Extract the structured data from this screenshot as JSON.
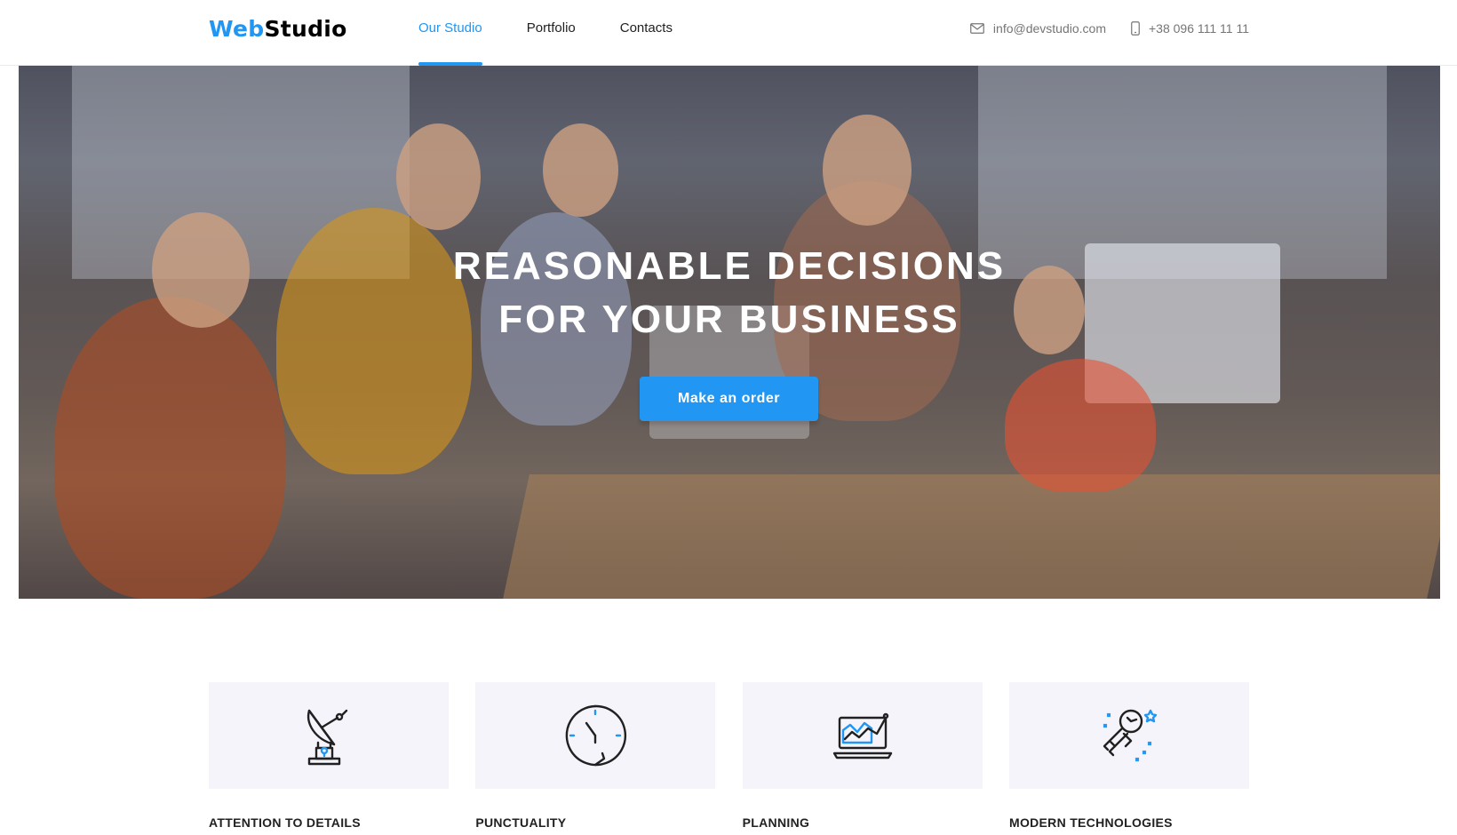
{
  "header": {
    "logo": {
      "part1": "Web",
      "part2": "Studio"
    },
    "nav": [
      {
        "label": "Our Studio",
        "active": true
      },
      {
        "label": "Portfolio",
        "active": false
      },
      {
        "label": "Contacts",
        "active": false
      }
    ],
    "email": {
      "icon": "mail-icon",
      "text": "info@devstudio.com"
    },
    "phone": {
      "icon": "phone-icon",
      "text": "+38 096 111 11 11"
    }
  },
  "hero": {
    "title_line1": "Reasonable decisions",
    "title_line2": "for your business",
    "button": "Make an order"
  },
  "features": [
    {
      "icon": "satellite-dish-icon",
      "title": "Attention to details"
    },
    {
      "icon": "clock-icon",
      "title": "Punctuality"
    },
    {
      "icon": "laptop-chart-icon",
      "title": "Planning"
    },
    {
      "icon": "astronaut-icon",
      "title": "Modern technologies"
    }
  ],
  "colors": {
    "accent": "#2196f3",
    "text": "#212121",
    "muted": "#757575",
    "card_bg": "#f5f4fa"
  }
}
